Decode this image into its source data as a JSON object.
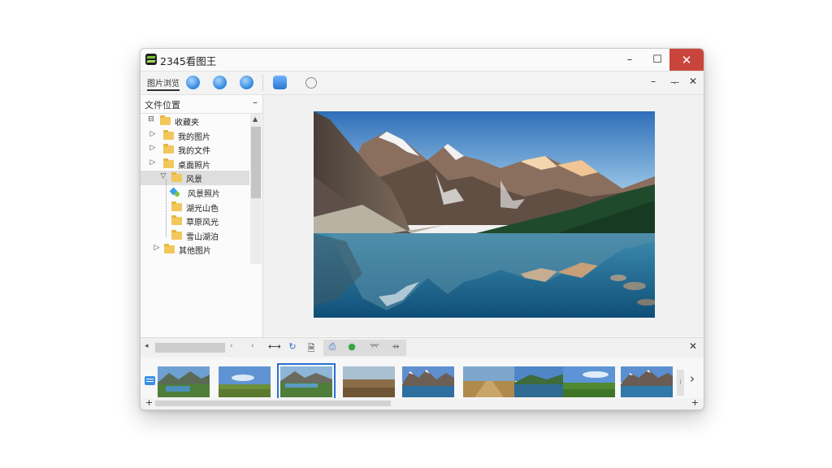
{
  "app": {
    "title": "2345看图王"
  },
  "window_controls": {
    "minimize": "–",
    "maximize": "☐",
    "close": "✕"
  },
  "toolbar": {
    "label": "图片浏览",
    "right": {
      "minimize": "–",
      "pin": "ᅮ",
      "close": "✕"
    }
  },
  "sidebar": {
    "title": "文件位置",
    "collapse": "–",
    "items": [
      {
        "label": "收藏夹",
        "exp": "⊟",
        "selected": false,
        "icon": "folder-icon"
      },
      {
        "label": "我的图片",
        "exp": "▷",
        "selected": false,
        "icon": "folder-icon"
      },
      {
        "label": "我的文件",
        "exp": "▷",
        "selected": false,
        "icon": "folder-icon"
      },
      {
        "label": "桌面照片",
        "exp": "▷",
        "selected": false,
        "icon": "folder-icon"
      },
      {
        "label": "风景",
        "exp": "▽",
        "selected": true,
        "icon": "folder-icon"
      },
      {
        "label": "风景照片",
        "exp": "",
        "selected": false,
        "icon": "special-folder-icon"
      },
      {
        "label": "湖光山色",
        "exp": "",
        "selected": false,
        "icon": "folder-icon"
      },
      {
        "label": "草原风光",
        "exp": "",
        "selected": false,
        "icon": "folder-icon"
      },
      {
        "label": "雪山湖泊",
        "exp": "",
        "selected": false,
        "icon": "folder-icon"
      },
      {
        "label": "其他图片",
        "exp": "▷",
        "selected": false,
        "icon": "folder-icon"
      }
    ]
  },
  "scroll": {
    "up": "▲",
    "left": "◂",
    "right": "›"
  },
  "bottom_toolbar": {
    "icons": [
      "fit-width-icon",
      "rotate-icon",
      "save-icon",
      "print-icon",
      "share-icon",
      "crop-icon",
      "compare-icon"
    ],
    "glyphs": [
      "⟷",
      "↻",
      "🗎",
      "⎙",
      "●",
      "⌤",
      "⇸"
    ],
    "close": "✕"
  },
  "thumbnails": [
    {
      "scene": "lake-valley",
      "selected": false
    },
    {
      "scene": "green-plain",
      "selected": false
    },
    {
      "scene": "mountain-lake",
      "selected": true
    },
    {
      "scene": "dry-field",
      "selected": false
    },
    {
      "scene": "snow-peaks",
      "selected": false
    },
    {
      "scene": "desert-road",
      "selected": false
    },
    {
      "scene": "hill-lake",
      "selected": false
    },
    {
      "scene": "grassland",
      "selected": false
    },
    {
      "scene": "alpine-lake",
      "selected": false
    }
  ],
  "strip": {
    "next": "›",
    "marker": "⁝"
  },
  "status": {
    "plus_left": "+",
    "plus_right": "+"
  },
  "colors": {
    "close_red": "#c9453c",
    "accent_blue": "#2a6fd1",
    "folder": "#f2c75b"
  }
}
